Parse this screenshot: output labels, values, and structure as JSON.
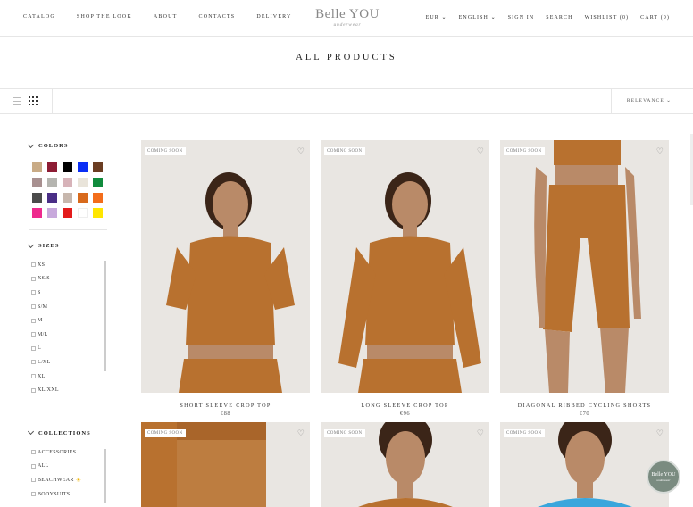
{
  "header": {
    "nav_left": [
      "CATALOG",
      "SHOP THE LOOK",
      "ABOUT",
      "CONTACTS",
      "DELIVERY"
    ],
    "logo_main": "Belle YOU",
    "logo_sub": "underwear",
    "currency": "EUR",
    "language": "ENGLISH",
    "sign_in": "SIGN IN",
    "search": "SEARCH",
    "wishlist": "WISHLIST (0)",
    "cart": "CART (0)"
  },
  "page_title": "ALL PRODUCTS",
  "toolbar": {
    "sort_label": "RELEVANCE"
  },
  "filters": {
    "colors_title": "COLORS",
    "colors": [
      "#c9ab86",
      "#8d1c34",
      "#000000",
      "#0a2ef5",
      "#6b3d22",
      "#a89090",
      "#b5b5b0",
      "#d7b3b9",
      "#e9e4da",
      "#108b3c",
      "#4b4b4b",
      "#4a2e86",
      "#c7b7ad",
      "#d86a1c",
      "#f36d1b",
      "#ee2a8e",
      "#c8a9dc",
      "#e31b1b",
      "#ffffff",
      "#ffe600"
    ],
    "sizes_title": "SIZES",
    "sizes": [
      "XS",
      "XS/S",
      "S",
      "S/M",
      "M",
      "M/L",
      "L",
      "L/XL",
      "XL",
      "XL/XXL"
    ],
    "collections_title": "COLLECTIONS",
    "collections": [
      "ACCESSORIES",
      "ALL",
      "BEACHWEAR",
      "BODYSUITS"
    ]
  },
  "products": [
    {
      "badge": "COMING SOON",
      "name": "SHORT SLEEVE CROP TOP",
      "price": "€88",
      "color": "#b8712f",
      "type": "crop"
    },
    {
      "badge": "COMING SOON",
      "name": "LONG SLEEVE CROP TOP",
      "price": "€96",
      "color": "#b8712f",
      "type": "long"
    },
    {
      "badge": "COMING SOON",
      "name": "DIAGONAL RIBBED CYCLING SHORTS",
      "price": "€70",
      "color": "#b8712f",
      "type": "shorts"
    },
    {
      "badge": "COMING SOON",
      "color": "#b8712f"
    },
    {
      "badge": "COMING SOON",
      "color": "#b8712f"
    },
    {
      "badge": "COMING SOON",
      "color": "#3aa6dc"
    }
  ],
  "chat": {
    "line1": "Belle YOU",
    "line2": "underwear"
  }
}
